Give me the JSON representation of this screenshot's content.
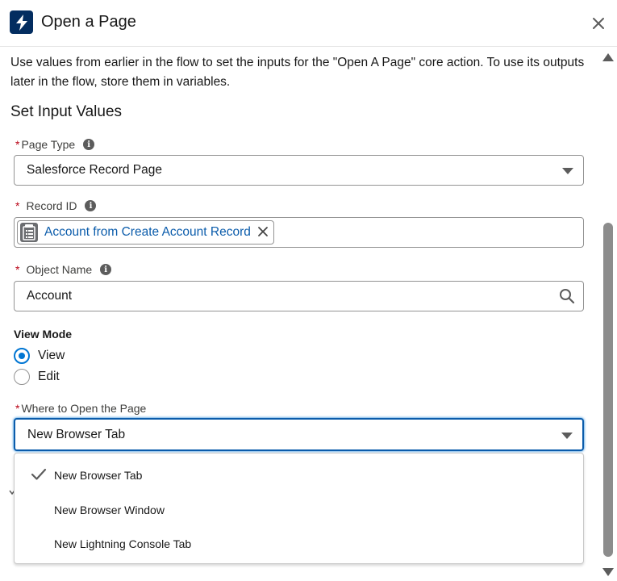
{
  "header": {
    "title": "Open a Page",
    "icon": "lightning-bolt-icon",
    "icon_bg": "#032d60"
  },
  "description": "Use values from earlier in the flow to set the inputs for the \"Open A Page\" core action. To use its outputs later in the flow, store them in variables.",
  "section_title": "Set Input Values",
  "fields": {
    "page_type": {
      "required_mark": "*",
      "label": "Page Type",
      "value": "Salesforce Record Page"
    },
    "record_id": {
      "required_mark": "*",
      "label": "Record ID",
      "pill_label": "Account from Create Account Record",
      "pill_icon": "record-resource-icon"
    },
    "object_name": {
      "required_mark": "*",
      "label": "Object Name",
      "value": "Account"
    },
    "where_to_open": {
      "required_mark": "*",
      "label": "Where to Open the Page",
      "value": "New Browser Tab"
    }
  },
  "view_mode": {
    "label": "View Mode",
    "options": [
      {
        "label": "View",
        "checked": true
      },
      {
        "label": "Edit",
        "checked": false
      }
    ]
  },
  "dropdown": {
    "options": [
      {
        "label": "New Browser Tab",
        "selected": true
      },
      {
        "label": "New Browser Window",
        "selected": false
      },
      {
        "label": "New Lightning Console Tab",
        "selected": false
      }
    ]
  },
  "colors": {
    "accent": "#0176d3",
    "focus_border": "#0b5cab",
    "required": "#ba0517",
    "pill_text": "#0b5cab"
  }
}
